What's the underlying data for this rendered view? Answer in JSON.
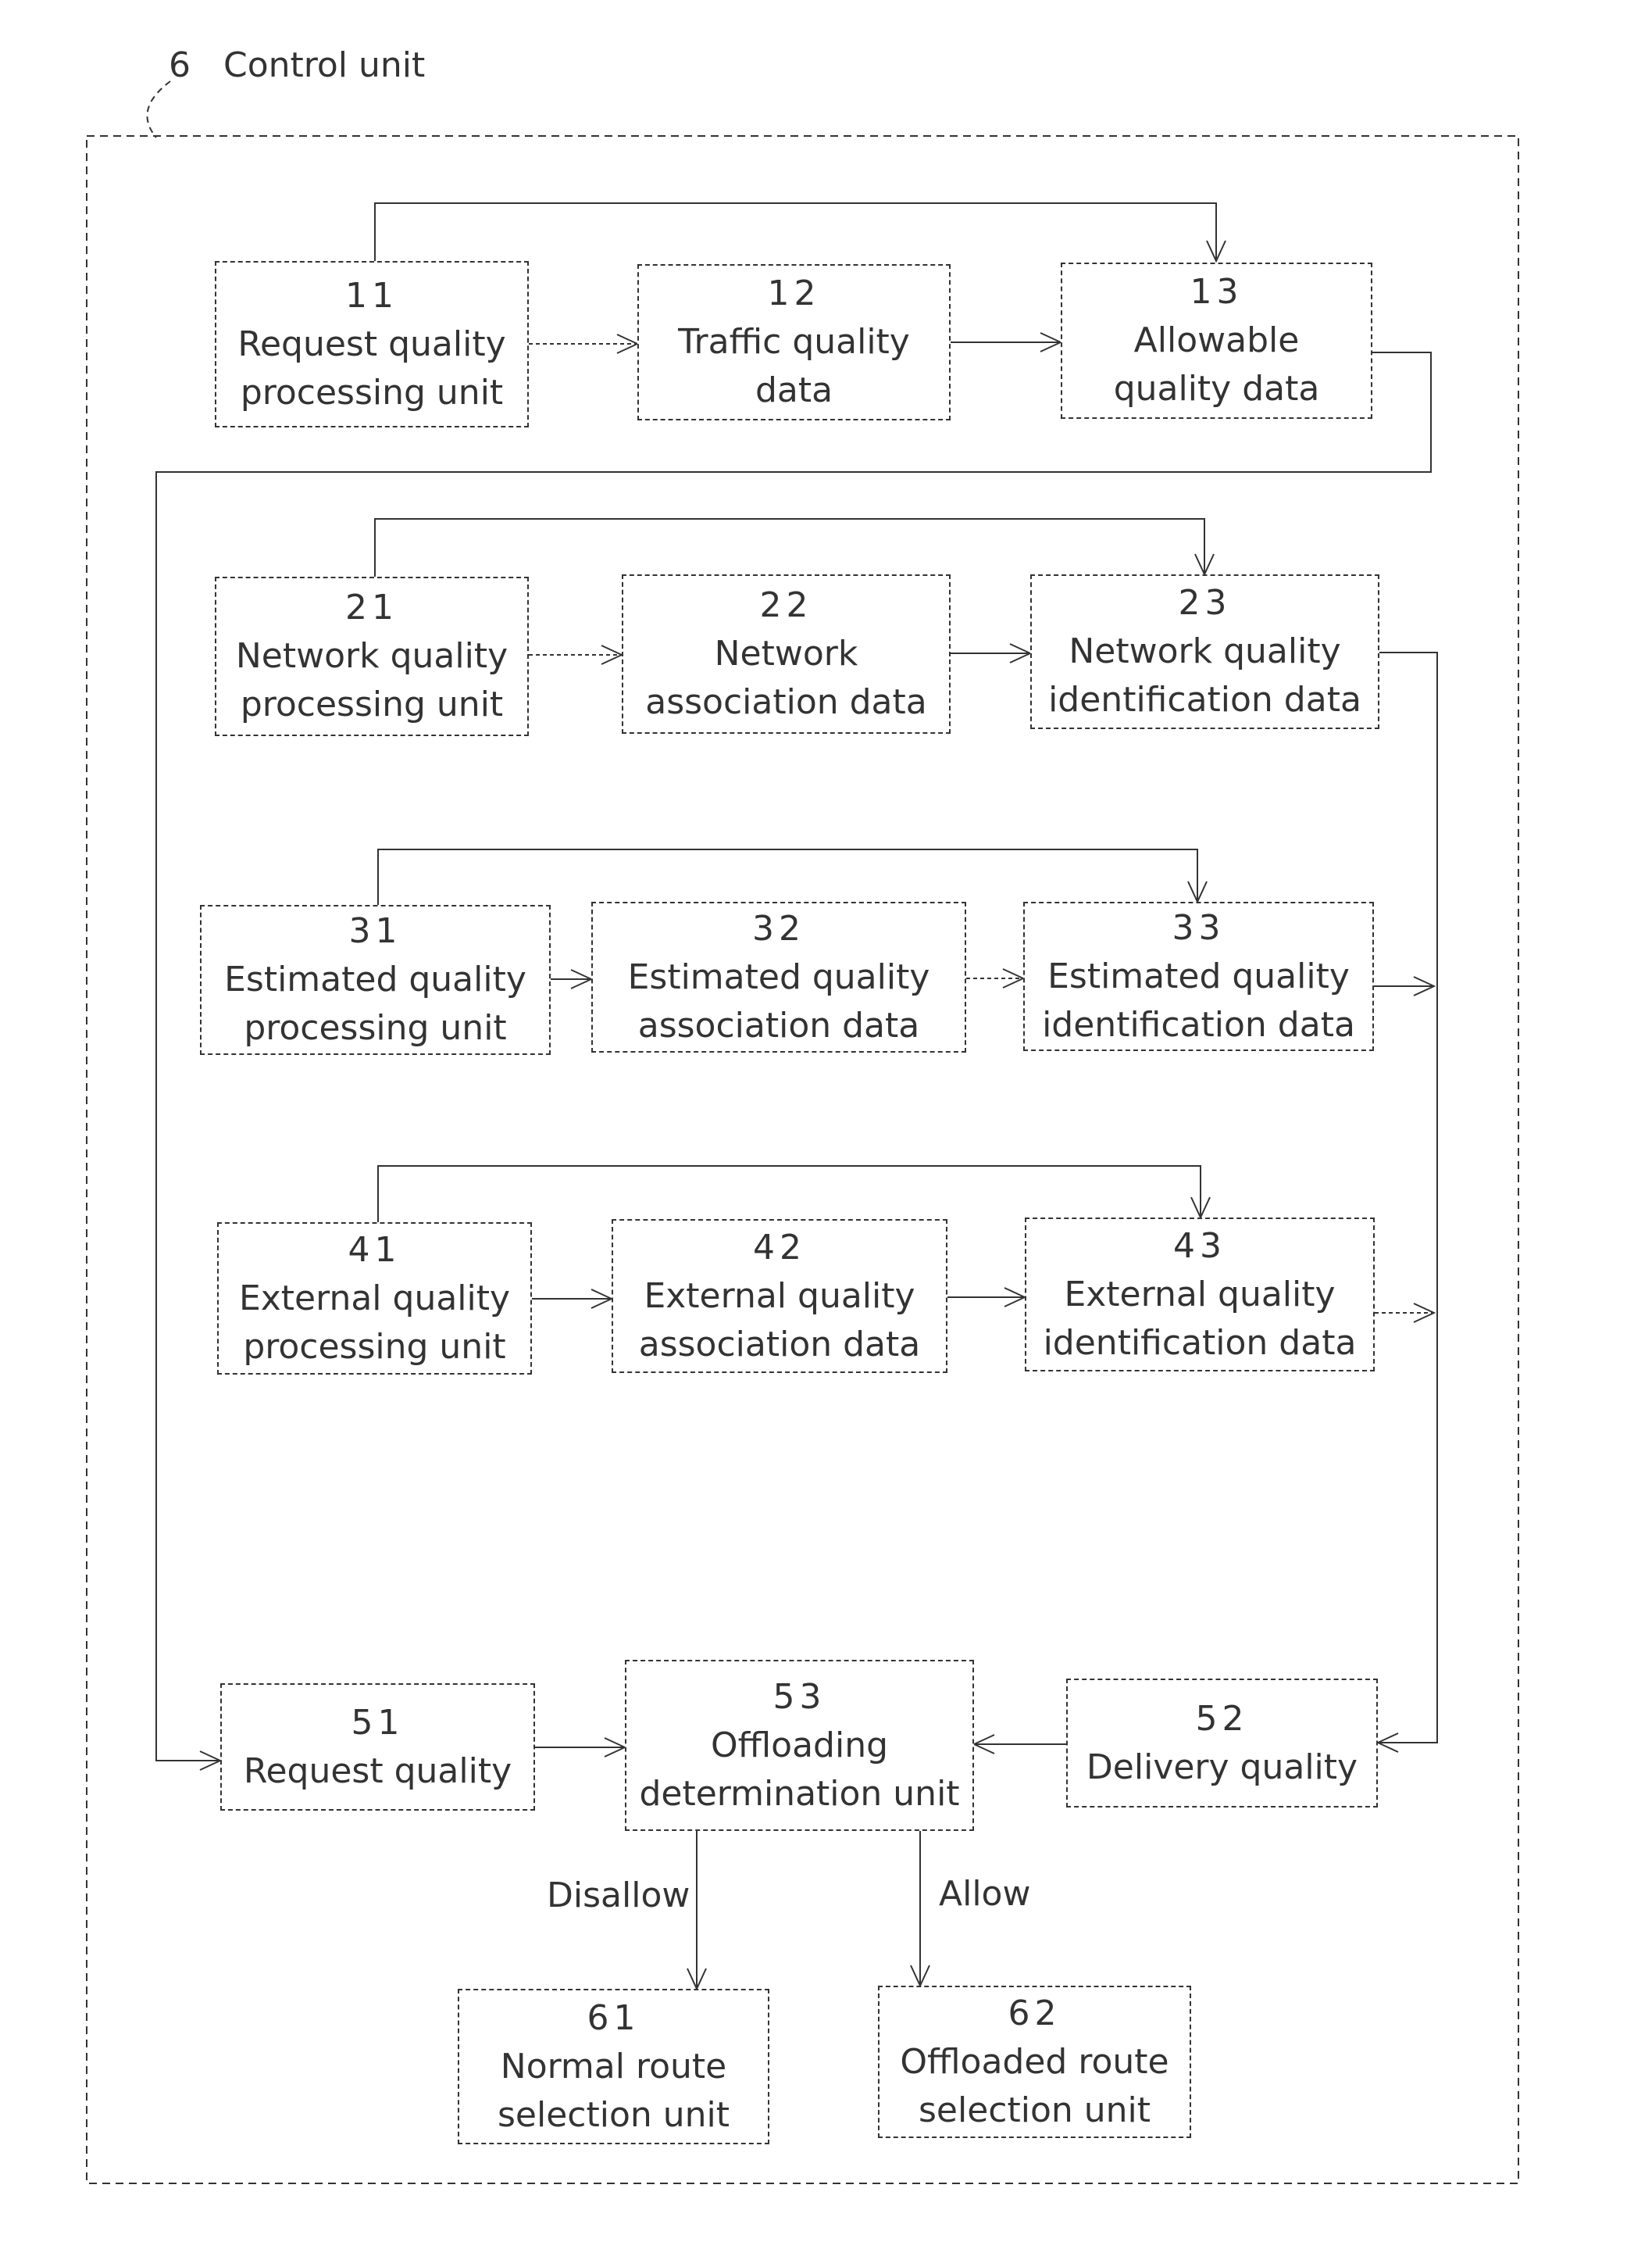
{
  "container": {
    "number": "6",
    "title": "Control unit"
  },
  "boxes": {
    "b11": {
      "number": "11",
      "line1": "Request quality",
      "line2": "processing unit"
    },
    "b12": {
      "number": "12",
      "line1": "Traffic quality",
      "line2": "data"
    },
    "b13": {
      "number": "13",
      "line1": "Allowable",
      "line2": "quality data"
    },
    "b21": {
      "number": "21",
      "line1": "Network quality",
      "line2": "processing unit"
    },
    "b22": {
      "number": "22",
      "line1": "Network",
      "line2": "association data"
    },
    "b23": {
      "number": "23",
      "line1": "Network quality",
      "line2": "identification data"
    },
    "b31": {
      "number": "31",
      "line1": "Estimated quality",
      "line2": "processing unit"
    },
    "b32": {
      "number": "32",
      "line1": "Estimated quality",
      "line2": "association data"
    },
    "b33": {
      "number": "33",
      "line1": "Estimated quality",
      "line2": "identification data"
    },
    "b41": {
      "number": "41",
      "line1": "External quality",
      "line2": "processing unit"
    },
    "b42": {
      "number": "42",
      "line1": "External quality",
      "line2": "association data"
    },
    "b43": {
      "number": "43",
      "line1": "External quality",
      "line2": "identification data"
    },
    "b51": {
      "number": "51",
      "line1": "Request quality"
    },
    "b52": {
      "number": "52",
      "line1": "Delivery quality"
    },
    "b53": {
      "number": "53",
      "line1": "Offloading",
      "line2": "determination unit"
    },
    "b61": {
      "number": "61",
      "line1": "Normal route",
      "line2": "selection unit"
    },
    "b62": {
      "number": "62",
      "line1": "Offloaded route",
      "line2": "selection unit"
    }
  },
  "edge_labels": {
    "disallow": "Disallow",
    "allow": "Allow"
  }
}
